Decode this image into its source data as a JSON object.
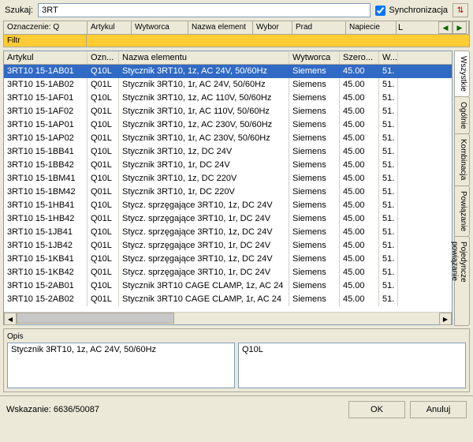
{
  "search": {
    "label": "Szukaj:",
    "value": "3RT",
    "sync_label": "Synchronizacja"
  },
  "header_cols": [
    "Oznaczenie: Q",
    "Artykul",
    "Wytworca",
    "Nazwa element",
    "Wybor",
    "Prad",
    "Napiecie",
    "L"
  ],
  "filter_label": "Filtr",
  "table": {
    "headers": [
      "Artykul",
      "Ozn...",
      "Nazwa elementu",
      "Wytworca",
      "Szero...",
      "W..."
    ],
    "rows": [
      {
        "art": "3RT10 15-1AB01",
        "ozn": "Q10L",
        "naz": "Stycznik 3RT10, 1z, AC 24V,  50/60Hz",
        "wyt": "Siemens",
        "szer": "45.00",
        "w": "51."
      },
      {
        "art": "3RT10 15-1AB02",
        "ozn": "Q01L",
        "naz": "Stycznik 3RT10, 1r, AC 24V,  50/60Hz",
        "wyt": "Siemens",
        "szer": "45.00",
        "w": "51."
      },
      {
        "art": "3RT10 15-1AF01",
        "ozn": "Q10L",
        "naz": "Stycznik 3RT10, 1z, AC 110V,  50/60Hz",
        "wyt": "Siemens",
        "szer": "45.00",
        "w": "51."
      },
      {
        "art": "3RT10 15-1AF02",
        "ozn": "Q01L",
        "naz": "Stycznik 3RT10, 1r, AC 110V,  50/60Hz",
        "wyt": "Siemens",
        "szer": "45.00",
        "w": "51."
      },
      {
        "art": "3RT10 15-1AP01",
        "ozn": "Q10L",
        "naz": "Stycznik 3RT10, 1z, AC 230V,  50/60Hz",
        "wyt": "Siemens",
        "szer": "45.00",
        "w": "51."
      },
      {
        "art": "3RT10 15-1AP02",
        "ozn": "Q01L",
        "naz": "Stycznik 3RT10, 1r, AC 230V,  50/60Hz",
        "wyt": "Siemens",
        "szer": "45.00",
        "w": "51."
      },
      {
        "art": "3RT10 15-1BB41",
        "ozn": "Q10L",
        "naz": "Stycznik 3RT10, 1z, DC 24V",
        "wyt": "Siemens",
        "szer": "45.00",
        "w": "51."
      },
      {
        "art": "3RT10 15-1BB42",
        "ozn": "Q01L",
        "naz": "Stycznik 3RT10, 1r, DC 24V",
        "wyt": "Siemens",
        "szer": "45.00",
        "w": "51."
      },
      {
        "art": "3RT10 15-1BM41",
        "ozn": "Q10L",
        "naz": "Stycznik 3RT10, 1z, DC 220V",
        "wyt": "Siemens",
        "szer": "45.00",
        "w": "51."
      },
      {
        "art": "3RT10 15-1BM42",
        "ozn": "Q01L",
        "naz": "Stycznik 3RT10, 1r, DC 220V",
        "wyt": "Siemens",
        "szer": "45.00",
        "w": "51."
      },
      {
        "art": "3RT10 15-1HB41",
        "ozn": "Q10L",
        "naz": "Stycz. sprzęgające 3RT10, 1z, DC 24V",
        "wyt": "Siemens",
        "szer": "45.00",
        "w": "51."
      },
      {
        "art": "3RT10 15-1HB42",
        "ozn": "Q01L",
        "naz": "Stycz. sprzęgające 3RT10, 1r, DC 24V",
        "wyt": "Siemens",
        "szer": "45.00",
        "w": "51."
      },
      {
        "art": "3RT10 15-1JB41",
        "ozn": "Q10L",
        "naz": "Stycz. sprzęgające 3RT10, 1z, DC 24V",
        "wyt": "Siemens",
        "szer": "45.00",
        "w": "51."
      },
      {
        "art": "3RT10 15-1JB42",
        "ozn": "Q01L",
        "naz": "Stycz. sprzęgające 3RT10, 1r, DC 24V",
        "wyt": "Siemens",
        "szer": "45.00",
        "w": "51."
      },
      {
        "art": "3RT10 15-1KB41",
        "ozn": "Q10L",
        "naz": "Stycz. sprzęgające 3RT10, 1z, DC 24V",
        "wyt": "Siemens",
        "szer": "45.00",
        "w": "51."
      },
      {
        "art": "3RT10 15-1KB42",
        "ozn": "Q01L",
        "naz": "Stycz. sprzęgające 3RT10, 1r, DC 24V",
        "wyt": "Siemens",
        "szer": "45.00",
        "w": "51."
      },
      {
        "art": "3RT10 15-2AB01",
        "ozn": "Q10L",
        "naz": "Stycznik 3RT10 CAGE CLAMP, 1z, AC 24",
        "wyt": "Siemens",
        "szer": "45.00",
        "w": "51."
      },
      {
        "art": "3RT10 15-2AB02",
        "ozn": "Q01L",
        "naz": "Stycznik 3RT10 CAGE CLAMP, 1r, AC 24",
        "wyt": "Siemens",
        "szer": "45.00",
        "w": "51."
      }
    ],
    "selected": 0
  },
  "vtabs": [
    "Wszystkie",
    "Ogólnie",
    "Kombinacja",
    "Powiązanie",
    "Pojedyncze powiązanie"
  ],
  "vtab_active": 0,
  "desc": {
    "label": "Opis",
    "box1": "Stycznik 3RT10, 1z, AC 24V,  50/60Hz",
    "box2": "Q10L"
  },
  "status": "Wskazanie: 6636/50087",
  "buttons": {
    "ok": "OK",
    "cancel": "Anuluj"
  }
}
